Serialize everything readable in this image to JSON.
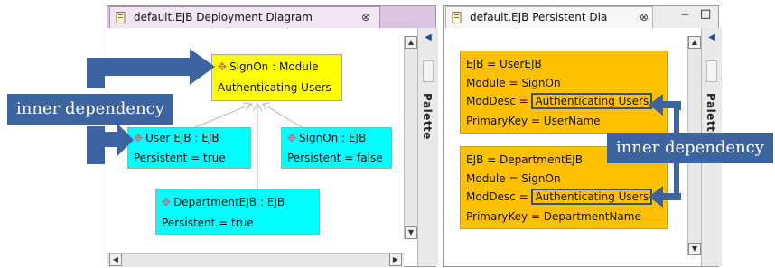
{
  "left_panel": {
    "tab_title": "default.EJB Deployment Diagram",
    "close_glyph": "⊗",
    "palette_label": "Palette",
    "nodes": {
      "signon_module": {
        "title": "SignOn : Module",
        "attr": "Authenticating Users"
      },
      "user_ejb": {
        "title": "User EJB : EJB",
        "attr": "Persistent = true"
      },
      "signon_ejb": {
        "title": "SignOn : EJB",
        "attr": "Persistent = false"
      },
      "department_ejb": {
        "title": "DepartmentEJB : EJB",
        "attr": "Persistent = true"
      }
    }
  },
  "right_panel": {
    "tab_title": "default.EJB Persistent Dia",
    "close_glyph": "⊗",
    "window_controls": [
      "−",
      "□"
    ],
    "palette_label": "Palette",
    "records": [
      {
        "ejb": "EJB = UserEJB",
        "module": "Module = SignOn",
        "moddesc_prefix": "ModDesc = ",
        "moddesc_value": "Authenticating Users",
        "primarykey": "PrimaryKey = UserName"
      },
      {
        "ejb": "EJB = DepartmentEJB",
        "module": "Module = SignOn",
        "moddesc_prefix": "ModDesc = ",
        "moddesc_value": "Authenticating Users",
        "primarykey": "PrimaryKey = DepartmentName"
      }
    ]
  },
  "callouts": {
    "left": "inner dependency",
    "right": "inner dependency"
  },
  "colors": {
    "module_node": "#ffff00",
    "ejb_node": "#00ffff",
    "persistent_record": "#ffc000",
    "callout": "#3b64a0",
    "left_tab_accent": "#c99ad0"
  }
}
